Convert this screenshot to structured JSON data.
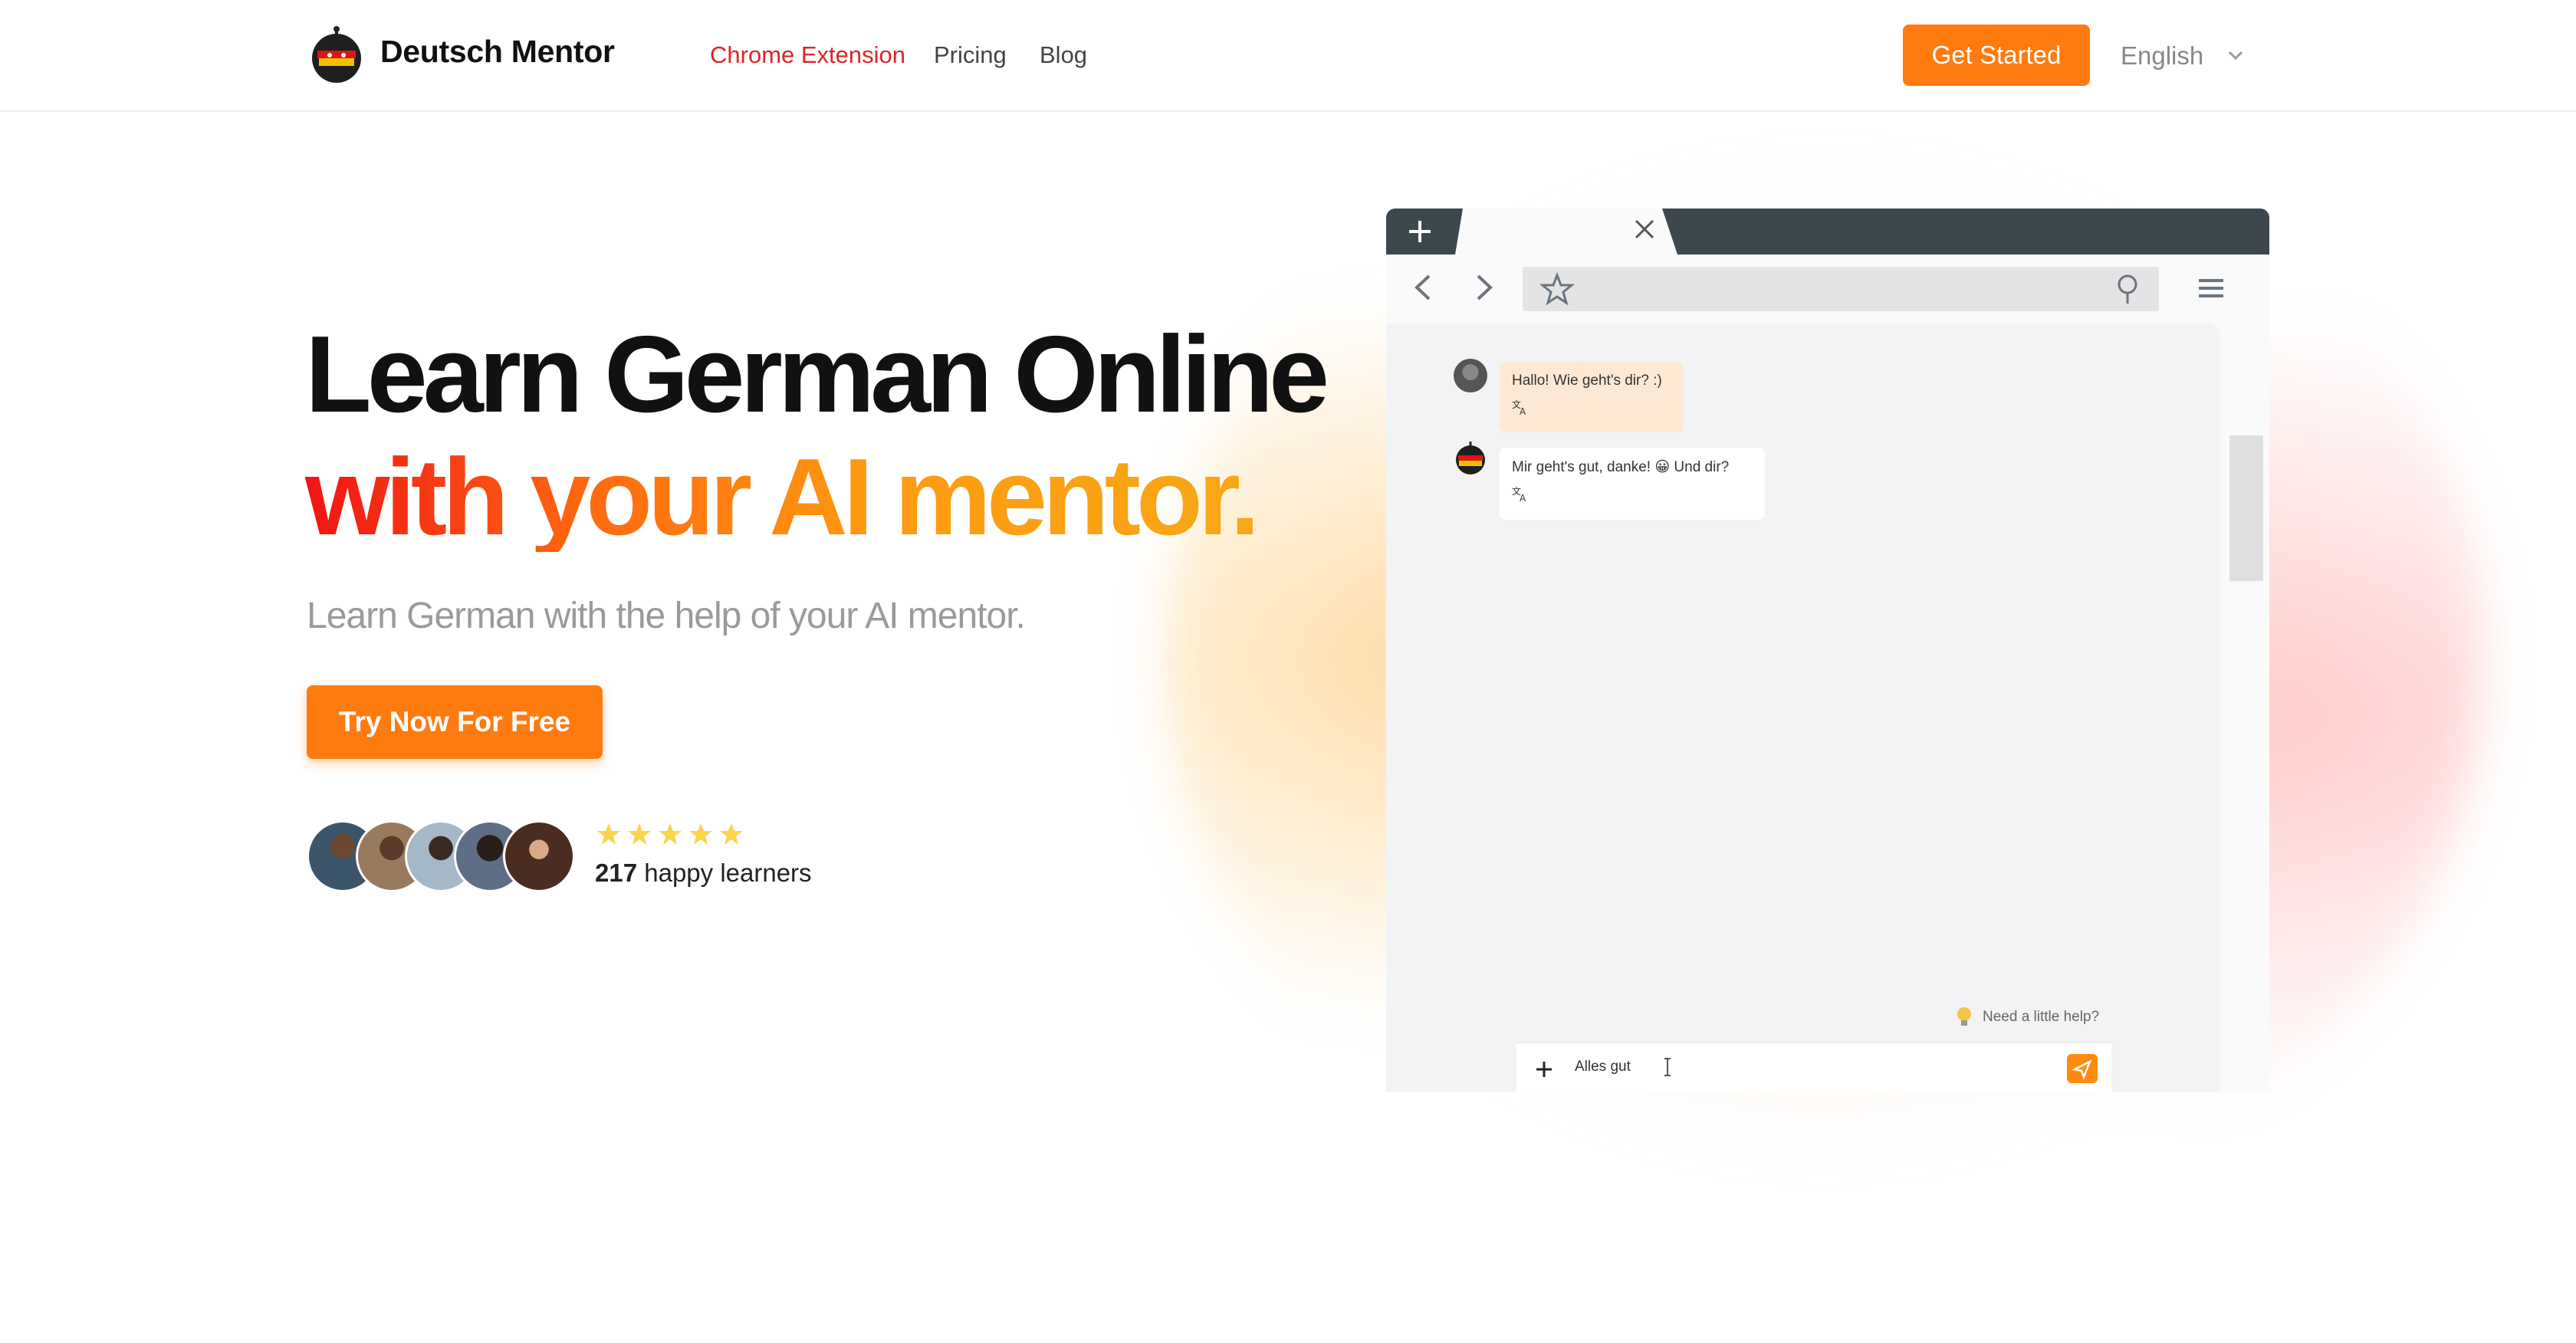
{
  "header": {
    "brand": "Deutsch Mentor",
    "nav": [
      "Chrome Extension",
      "Pricing",
      "Blog"
    ],
    "cta": "Get Started",
    "language": "English"
  },
  "hero": {
    "line1": "Learn German Online",
    "line2": "with your AI mentor.",
    "subtitle": "Learn German with the help of your AI mentor.",
    "cta": "Try Now For Free",
    "rating_stars": 5,
    "learners_count": "217",
    "learners_label": "happy learners"
  },
  "mockup": {
    "messages": [
      {
        "text": "Hallo! Wie geht's dir? :)"
      },
      {
        "text": "Mir geht's gut, danke! 😀 Und dir?"
      }
    ],
    "help_text": "Need a little help?",
    "input_value": "Alles gut"
  },
  "colors": {
    "accent": "#ff7a0f",
    "nav_active": "#e02424",
    "gradient_start": "#f01414",
    "gradient_end": "#f8a818"
  }
}
